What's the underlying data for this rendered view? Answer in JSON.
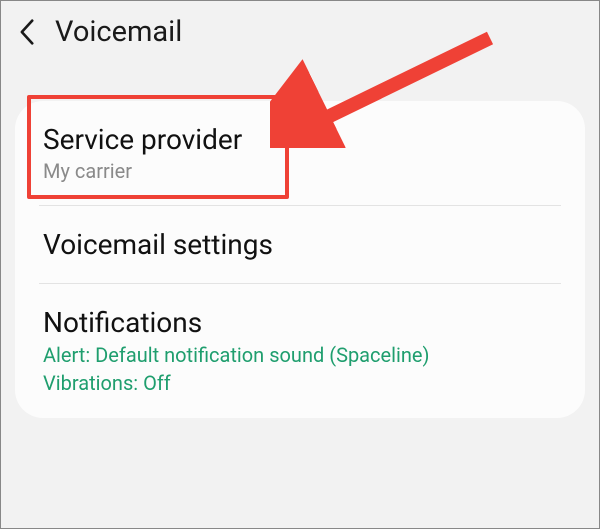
{
  "header": {
    "title": "Voicemail"
  },
  "items": {
    "service_provider": {
      "title": "Service provider",
      "subtitle": "My carrier"
    },
    "voicemail_settings": {
      "title": "Voicemail settings"
    },
    "notifications": {
      "title": "Notifications",
      "detail_line1": "Alert: Default notification sound (Spaceline)",
      "detail_line2": "Vibrations: Off"
    }
  }
}
